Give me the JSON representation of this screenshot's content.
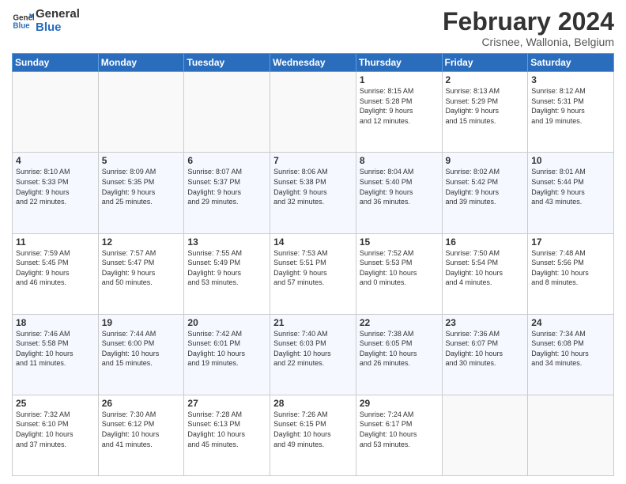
{
  "logo": {
    "line1": "General",
    "line2": "Blue"
  },
  "title": "February 2024",
  "subtitle": "Crisnee, Wallonia, Belgium",
  "weekdays": [
    "Sunday",
    "Monday",
    "Tuesday",
    "Wednesday",
    "Thursday",
    "Friday",
    "Saturday"
  ],
  "weeks": [
    [
      {
        "day": "",
        "info": ""
      },
      {
        "day": "",
        "info": ""
      },
      {
        "day": "",
        "info": ""
      },
      {
        "day": "",
        "info": ""
      },
      {
        "day": "1",
        "info": "Sunrise: 8:15 AM\nSunset: 5:28 PM\nDaylight: 9 hours\nand 12 minutes."
      },
      {
        "day": "2",
        "info": "Sunrise: 8:13 AM\nSunset: 5:29 PM\nDaylight: 9 hours\nand 15 minutes."
      },
      {
        "day": "3",
        "info": "Sunrise: 8:12 AM\nSunset: 5:31 PM\nDaylight: 9 hours\nand 19 minutes."
      }
    ],
    [
      {
        "day": "4",
        "info": "Sunrise: 8:10 AM\nSunset: 5:33 PM\nDaylight: 9 hours\nand 22 minutes."
      },
      {
        "day": "5",
        "info": "Sunrise: 8:09 AM\nSunset: 5:35 PM\nDaylight: 9 hours\nand 25 minutes."
      },
      {
        "day": "6",
        "info": "Sunrise: 8:07 AM\nSunset: 5:37 PM\nDaylight: 9 hours\nand 29 minutes."
      },
      {
        "day": "7",
        "info": "Sunrise: 8:06 AM\nSunset: 5:38 PM\nDaylight: 9 hours\nand 32 minutes."
      },
      {
        "day": "8",
        "info": "Sunrise: 8:04 AM\nSunset: 5:40 PM\nDaylight: 9 hours\nand 36 minutes."
      },
      {
        "day": "9",
        "info": "Sunrise: 8:02 AM\nSunset: 5:42 PM\nDaylight: 9 hours\nand 39 minutes."
      },
      {
        "day": "10",
        "info": "Sunrise: 8:01 AM\nSunset: 5:44 PM\nDaylight: 9 hours\nand 43 minutes."
      }
    ],
    [
      {
        "day": "11",
        "info": "Sunrise: 7:59 AM\nSunset: 5:45 PM\nDaylight: 9 hours\nand 46 minutes."
      },
      {
        "day": "12",
        "info": "Sunrise: 7:57 AM\nSunset: 5:47 PM\nDaylight: 9 hours\nand 50 minutes."
      },
      {
        "day": "13",
        "info": "Sunrise: 7:55 AM\nSunset: 5:49 PM\nDaylight: 9 hours\nand 53 minutes."
      },
      {
        "day": "14",
        "info": "Sunrise: 7:53 AM\nSunset: 5:51 PM\nDaylight: 9 hours\nand 57 minutes."
      },
      {
        "day": "15",
        "info": "Sunrise: 7:52 AM\nSunset: 5:53 PM\nDaylight: 10 hours\nand 0 minutes."
      },
      {
        "day": "16",
        "info": "Sunrise: 7:50 AM\nSunset: 5:54 PM\nDaylight: 10 hours\nand 4 minutes."
      },
      {
        "day": "17",
        "info": "Sunrise: 7:48 AM\nSunset: 5:56 PM\nDaylight: 10 hours\nand 8 minutes."
      }
    ],
    [
      {
        "day": "18",
        "info": "Sunrise: 7:46 AM\nSunset: 5:58 PM\nDaylight: 10 hours\nand 11 minutes."
      },
      {
        "day": "19",
        "info": "Sunrise: 7:44 AM\nSunset: 6:00 PM\nDaylight: 10 hours\nand 15 minutes."
      },
      {
        "day": "20",
        "info": "Sunrise: 7:42 AM\nSunset: 6:01 PM\nDaylight: 10 hours\nand 19 minutes."
      },
      {
        "day": "21",
        "info": "Sunrise: 7:40 AM\nSunset: 6:03 PM\nDaylight: 10 hours\nand 22 minutes."
      },
      {
        "day": "22",
        "info": "Sunrise: 7:38 AM\nSunset: 6:05 PM\nDaylight: 10 hours\nand 26 minutes."
      },
      {
        "day": "23",
        "info": "Sunrise: 7:36 AM\nSunset: 6:07 PM\nDaylight: 10 hours\nand 30 minutes."
      },
      {
        "day": "24",
        "info": "Sunrise: 7:34 AM\nSunset: 6:08 PM\nDaylight: 10 hours\nand 34 minutes."
      }
    ],
    [
      {
        "day": "25",
        "info": "Sunrise: 7:32 AM\nSunset: 6:10 PM\nDaylight: 10 hours\nand 37 minutes."
      },
      {
        "day": "26",
        "info": "Sunrise: 7:30 AM\nSunset: 6:12 PM\nDaylight: 10 hours\nand 41 minutes."
      },
      {
        "day": "27",
        "info": "Sunrise: 7:28 AM\nSunset: 6:13 PM\nDaylight: 10 hours\nand 45 minutes."
      },
      {
        "day": "28",
        "info": "Sunrise: 7:26 AM\nSunset: 6:15 PM\nDaylight: 10 hours\nand 49 minutes."
      },
      {
        "day": "29",
        "info": "Sunrise: 7:24 AM\nSunset: 6:17 PM\nDaylight: 10 hours\nand 53 minutes."
      },
      {
        "day": "",
        "info": ""
      },
      {
        "day": "",
        "info": ""
      }
    ]
  ]
}
